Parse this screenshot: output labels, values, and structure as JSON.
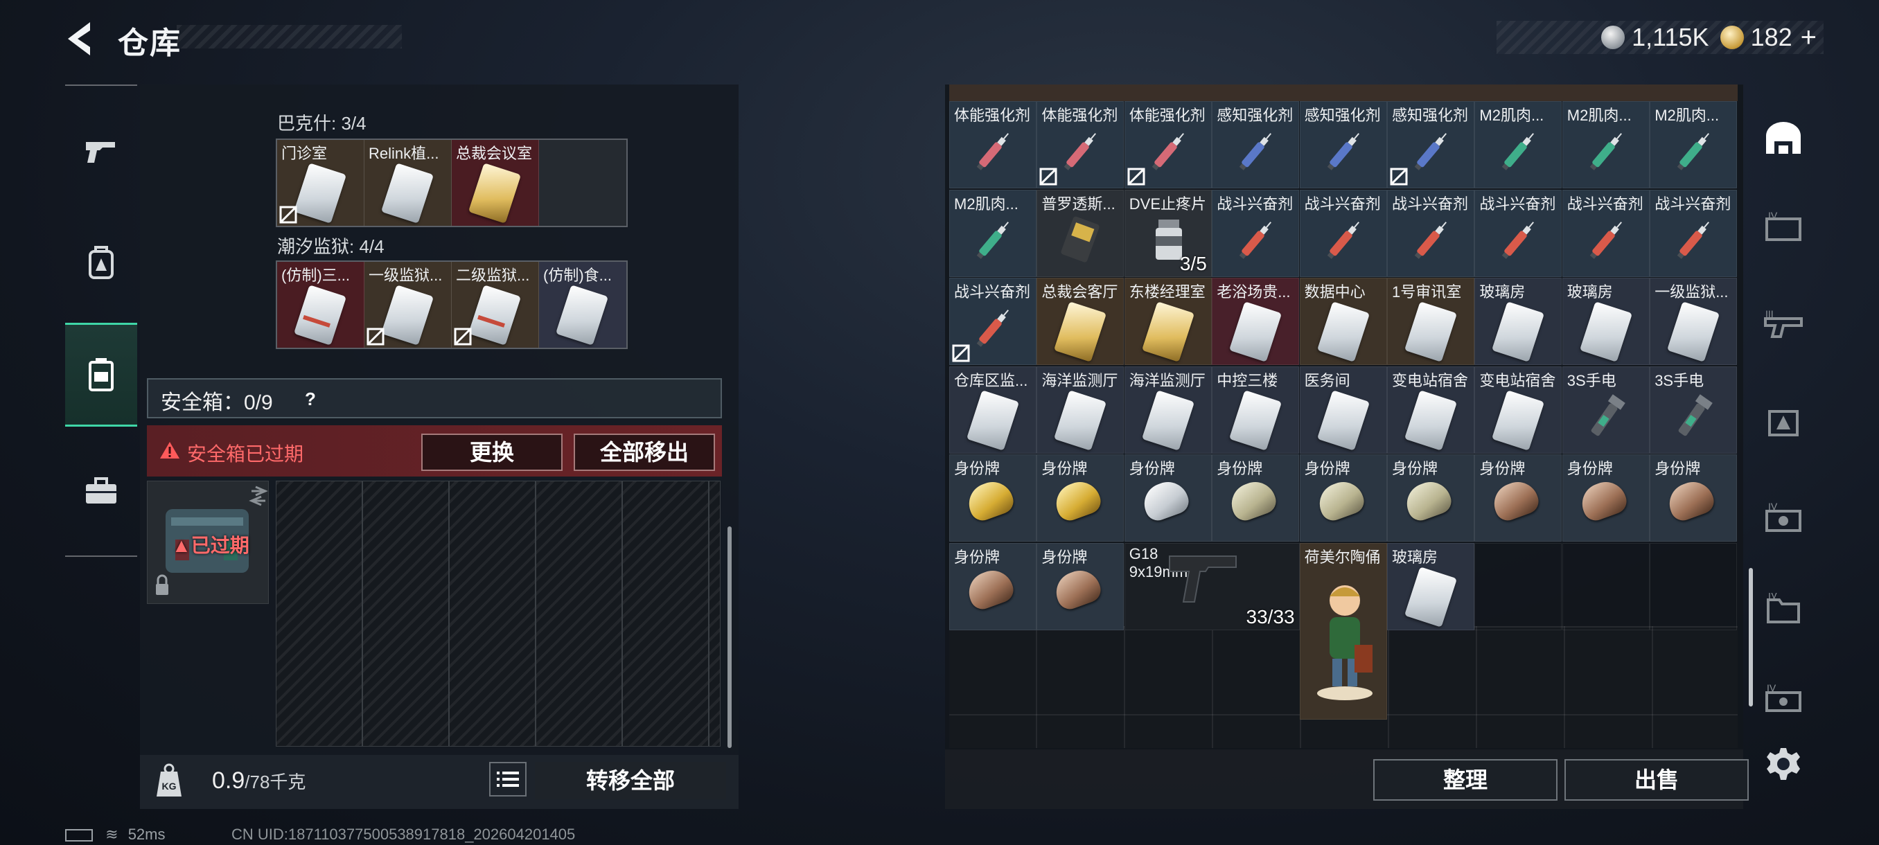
{
  "header": {
    "title": "仓库"
  },
  "currency": [
    {
      "value": "1,115K",
      "icon": "silver-coin-icon"
    },
    {
      "value": "182",
      "icon": "gold-coin-icon"
    }
  ],
  "currency_plus": "+",
  "stash": {
    "groups": [
      {
        "label": "巴克什: 3/4",
        "items": [
          "门诊室",
          "Relink植...",
          "总裁会议室",
          ""
        ]
      },
      {
        "label": "潮汐监狱: 4/4",
        "items": [
          "(仿制)三...",
          "一级监狱...",
          "二级监狱...",
          "(仿制)食..."
        ]
      }
    ]
  },
  "safebox": {
    "label": "安全箱：0/9",
    "help": "?",
    "expired_label": "安全箱已过期",
    "replace_button": "更换",
    "move_all_button": "全部移出",
    "case_status": "已过期"
  },
  "weight": {
    "current": "0.9",
    "max": "/78千克",
    "icon_text": "KG"
  },
  "transfer_all": "转移全部",
  "inventory": {
    "rows": [
      [
        "体能强化剂",
        "体能强化剂",
        "体能强化剂",
        "感知强化剂",
        "感知强化剂",
        "感知强化剂",
        "M2肌肉...",
        "M2肌肉...",
        "M2肌肉..."
      ],
      [
        "M2肌肉...",
        "普罗透斯...",
        "DVE止疼片",
        "战斗兴奋剂",
        "战斗兴奋剂",
        "战斗兴奋剂",
        "战斗兴奋剂",
        "战斗兴奋剂",
        "战斗兴奋剂"
      ],
      [
        "战斗兴奋剂",
        "总裁会客厅",
        "东楼经理室",
        "老浴场贵...",
        "数据中心",
        "1号审讯室",
        "玻璃房",
        "玻璃房",
        "一级监狱..."
      ],
      [
        "仓库区监...",
        "海洋监测厅",
        "海洋监测厅",
        "中控三楼",
        "医务间",
        "变电站宿舍",
        "变电站宿舍",
        "3S手电",
        "3S手电"
      ],
      [
        "身份牌",
        "身份牌",
        "身份牌",
        "身份牌",
        "身份牌",
        "身份牌",
        "身份牌",
        "身份牌",
        "身份牌"
      ],
      [
        "身份牌",
        "身份牌",
        "G18\n9x19mm",
        "",
        "荷美尔陶俑",
        "玻璃房",
        "",
        "",
        ""
      ]
    ],
    "pill_count": "3/5",
    "ammo_count": "33/33"
  },
  "actions": {
    "sort": "整理",
    "sell": "出售"
  },
  "status_bar": {
    "ping": "52ms",
    "uid": "CN UID:18711037750053891781​8_202604201405"
  },
  "colors": {
    "accent": "#3fd6a7",
    "danger": "#ff6a6a",
    "expired_bg": "#5a1f24"
  }
}
